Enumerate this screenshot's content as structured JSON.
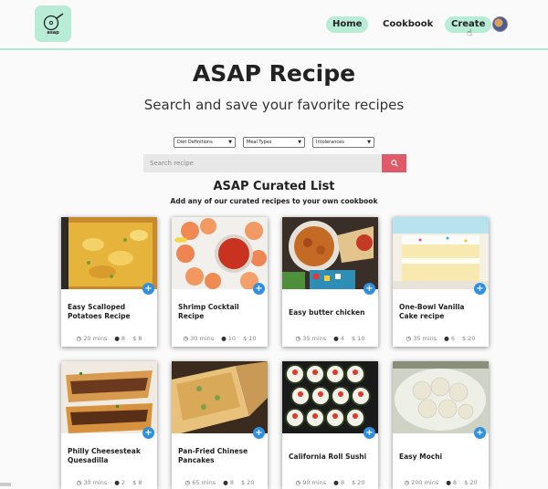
{
  "nav": {
    "logo_text": "asap",
    "links": [
      "Home",
      "Cookbook",
      "Create"
    ]
  },
  "hero": {
    "title": "ASAP Recipe",
    "subtitle": "Search and save your favorite recipes"
  },
  "filters": [
    "Diet Definitions",
    "Meal Types",
    "Intolerances"
  ],
  "search": {
    "placeholder": "Search recipe"
  },
  "curated": {
    "title": "ASAP Curated List",
    "subtitle": "Add any of our curated recipes to your own cookbook"
  },
  "recipes": [
    {
      "title": "Easy Scalloped Potatoes Recipe",
      "time": "20 mins",
      "servings": "8",
      "price": "$ 8"
    },
    {
      "title": "Shrimp Cocktail Recipe",
      "time": "30 mins",
      "servings": "10",
      "price": "$ 10"
    },
    {
      "title": "Easy butter chicken",
      "time": "35 mins",
      "servings": "4",
      "price": "$ 10"
    },
    {
      "title": "One-Bowl Vanilla Cake recipe",
      "time": "35 mins",
      "servings": "6",
      "price": "$ 20"
    },
    {
      "title": "Philly Cheesesteak Quesadilla",
      "time": "30 mins",
      "servings": "2",
      "price": "$ 8"
    },
    {
      "title": "Pan-Fried Chinese Pancakes",
      "time": "65 mins",
      "servings": "8",
      "price": "$ 20"
    },
    {
      "title": "California Roll Sushi",
      "time": "90 mins",
      "servings": "8",
      "price": "$ 20"
    },
    {
      "title": "Easy Mochi",
      "time": "200 mins",
      "servings": "8",
      "price": "$ 20"
    }
  ],
  "colors": {
    "accent": "#b8ecd6",
    "search_button": "#e05a6a",
    "add_button": "#2f8fe0"
  }
}
